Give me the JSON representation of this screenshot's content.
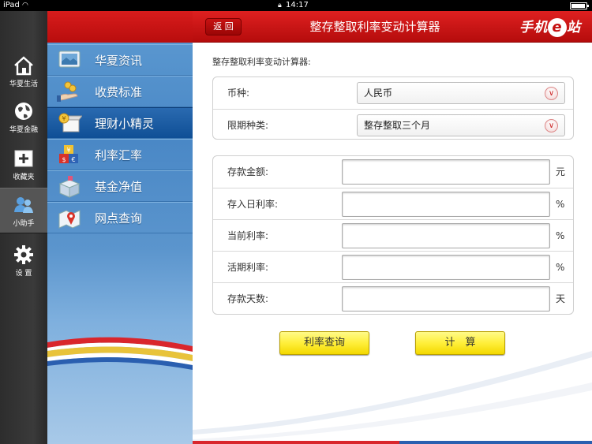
{
  "statusbar": {
    "carrier": "iPad",
    "time": "14:17"
  },
  "tabs": [
    {
      "label": "华夏生活",
      "icon": "house-icon"
    },
    {
      "label": "华夏金融",
      "icon": "globe-icon"
    },
    {
      "label": "收藏夹",
      "icon": "plus-icon"
    },
    {
      "label": "小助手",
      "icon": "people-icon"
    },
    {
      "label": "设 置",
      "icon": "gear-icon"
    }
  ],
  "active_tab": "小助手",
  "menu": {
    "items": [
      {
        "label": "华夏资讯",
        "icon": "news-screen-icon"
      },
      {
        "label": "收费标准",
        "icon": "hand-coins-icon"
      },
      {
        "label": "理财小精灵",
        "icon": "coin-box-icon"
      },
      {
        "label": "利率汇率",
        "icon": "currency-blocks-icon"
      },
      {
        "label": "基金净值",
        "icon": "gift-box-icon"
      },
      {
        "label": "网点查询",
        "icon": "map-pin-icon"
      }
    ],
    "active": "理财小精灵"
  },
  "header": {
    "back_label": "返 回",
    "title": "整存整取利率变动计算器",
    "brand_prefix": "手机",
    "brand_e": "e",
    "brand_suffix": "站"
  },
  "calculator": {
    "section_title": "整存整取利率变动计算器:",
    "selects": [
      {
        "label": "币种:",
        "value": "人民币"
      },
      {
        "label": "限期种类:",
        "value": "整存整取三个月"
      }
    ],
    "fields": [
      {
        "label": "存款金额:",
        "value": "",
        "unit": "元"
      },
      {
        "label": "存入日利率:",
        "value": "",
        "unit": "%"
      },
      {
        "label": "当前利率:",
        "value": "",
        "unit": "%"
      },
      {
        "label": "活期利率:",
        "value": "",
        "unit": "%"
      },
      {
        "label": "存款天数:",
        "value": "",
        "unit": "天"
      }
    ],
    "query_button": "利率查询",
    "calc_button": "计　算"
  },
  "colors": {
    "header_red": "#c8141a",
    "menu_blue": "#4a88c6",
    "button_yellow": "#ffef3a"
  }
}
